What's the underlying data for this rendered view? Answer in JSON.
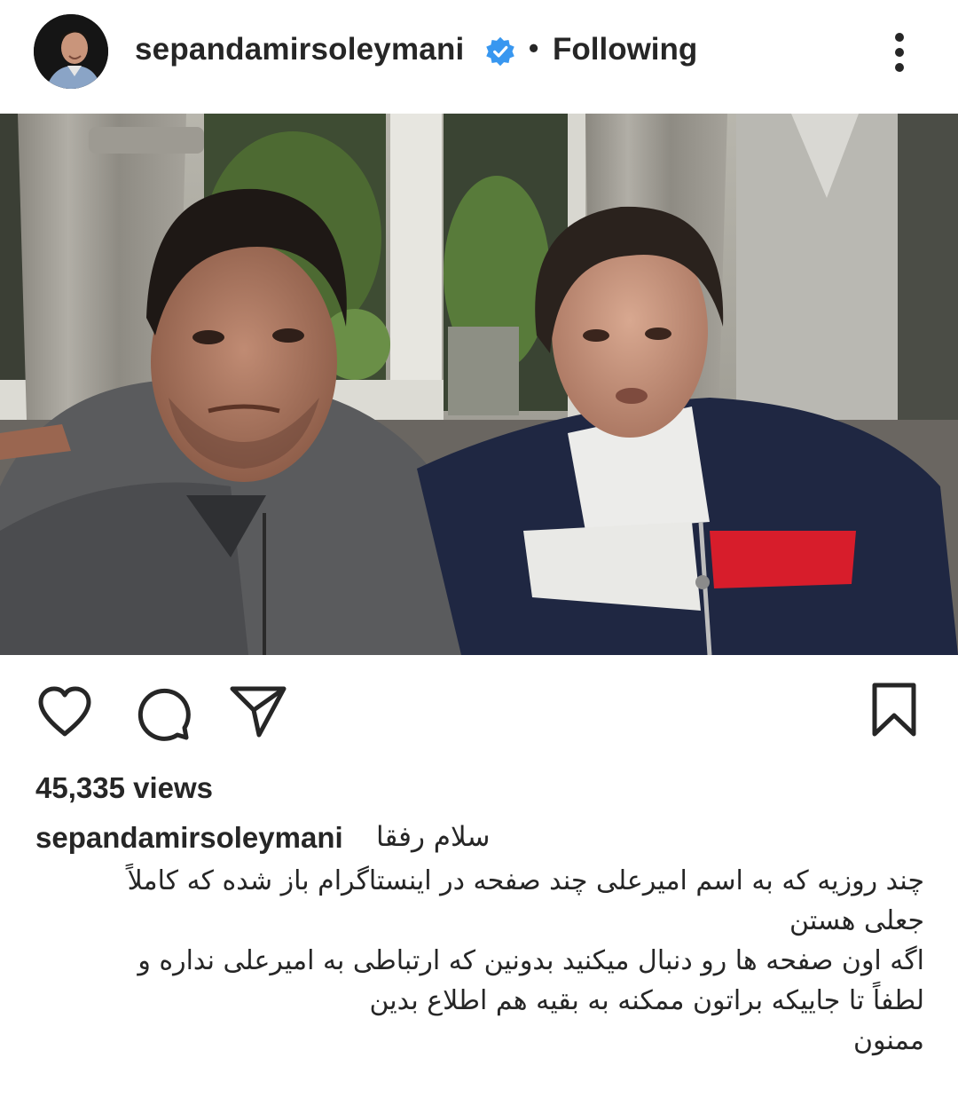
{
  "header": {
    "username": "sepandamirsoleymani",
    "separator": "•",
    "follow_status": "Following",
    "verified_icon": "verified-badge-icon",
    "more_icon": "more-vertical-icon"
  },
  "media": {
    "type": "video",
    "mute_icon": "volume-muted-icon"
  },
  "actions": {
    "like_icon": "heart-icon",
    "comment_icon": "comment-icon",
    "share_icon": "send-icon",
    "save_icon": "bookmark-icon"
  },
  "stats": {
    "views": "45,335 views"
  },
  "caption": {
    "username": "sepandamirsoleymani",
    "first_line": "سلام رفقا",
    "body": "چند روزیه که به اسم امیرعلی چند صفحه در اینستاگرام باز شده که کاملاً\nجعلی هستن\nاگه اون صفحه ها رو دنبال میکنید بدونین که ارتباطی به امیرعلی نداره و\nلطفاً تا جاییکه براتون ممکنه به بقیه هم اطلاع بدین\nممنون"
  },
  "colors": {
    "verified_blue": "#3897f0",
    "text": "#262626"
  }
}
